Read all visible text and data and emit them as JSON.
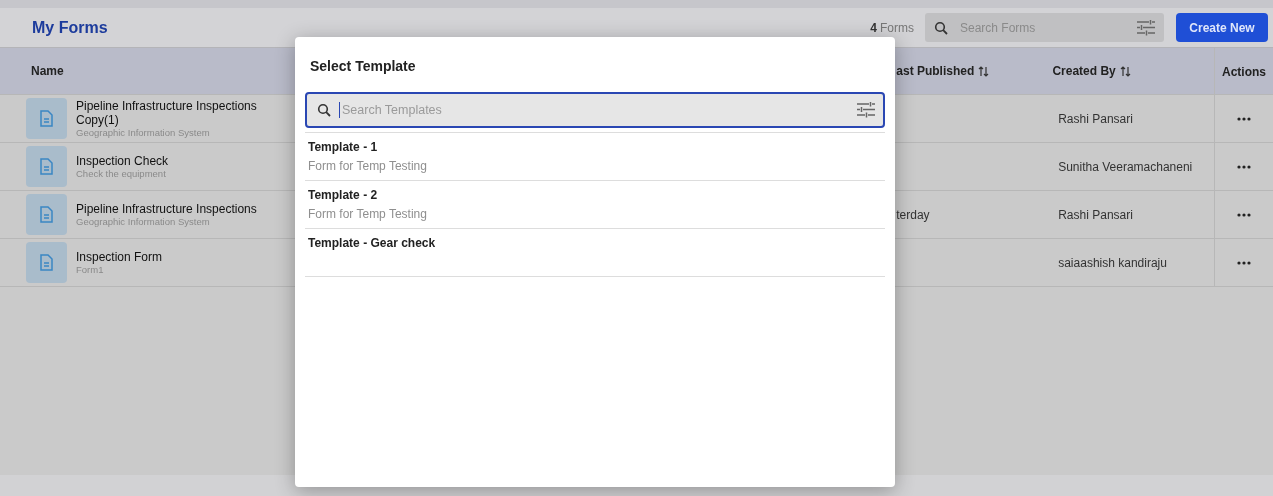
{
  "header": {
    "title": "My Forms",
    "count": "4",
    "count_label": "Forms",
    "search": {
      "placeholder": "Search Forms"
    },
    "create_button": "Create New"
  },
  "table": {
    "columns": [
      {
        "label": "Name",
        "sortable": false
      },
      {
        "label": "ast Published",
        "sortable": true
      },
      {
        "label": "Created By",
        "sortable": true
      },
      {
        "label": "Actions",
        "sortable": false
      }
    ],
    "rows": [
      {
        "name": "Pipeline Infrastructure Inspections Copy(1)",
        "description": "Geographic Information System",
        "created_by": "Rashi Pansari"
      },
      {
        "name": "Inspection Check",
        "description": "Check the equipment",
        "created_by": "Sunitha Veeramachaneni"
      },
      {
        "name": "Pipeline Infrastructure Inspections",
        "description": "Geographic Information System",
        "published": "terday",
        "created_by": "Rashi Pansari"
      },
      {
        "name": "Inspection Form",
        "description": "Form1",
        "created_by": "saiaashish kandiraju"
      }
    ]
  },
  "dialog": {
    "title": "Select Template",
    "search": {
      "placeholder": "Search Templates",
      "focused": true
    },
    "templates": [
      {
        "name": "Template - 1",
        "description": "Form for Temp Testing"
      },
      {
        "name": "Template - 2",
        "description": "Form for Temp Testing"
      },
      {
        "name": "Template - Gear check"
      }
    ]
  }
}
